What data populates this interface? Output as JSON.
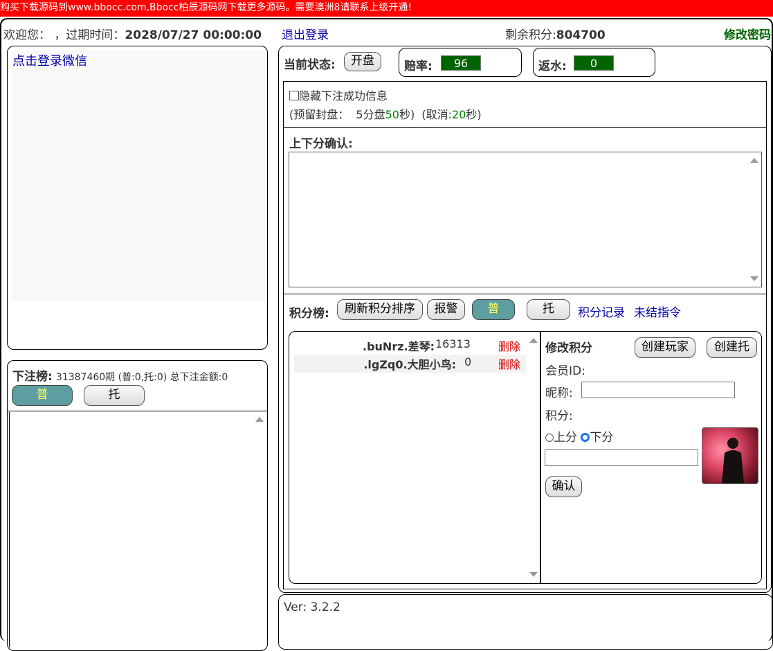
{
  "banner": {
    "text": "购买下载源码到www.bbocc.com,Bbocc柏辰源码网下载更多源码。需要澳洲8请联系上级开通!"
  },
  "header": {
    "welcome": "欢迎您： ，过期时间：",
    "expire": "2028/07/27 00:00:00",
    "logout": "退出登录",
    "points_label": "剩余积分:",
    "points_value": "804700",
    "change_password": "修改密码"
  },
  "wechat": {
    "login_link": "点击登录微信"
  },
  "bet_board": {
    "title": "下注榜:",
    "info": "31387460期  (普:0,托:0)  总下注金额:0",
    "btn_normal": "普",
    "btn_tuo": "托"
  },
  "status": {
    "label": "当前状态:",
    "open_btn": "开盘",
    "odds_label": "赔率:",
    "odds_value": "96",
    "rebate_label": "返水:",
    "rebate_value": "0"
  },
  "options": {
    "hide_success": "隐藏下注成功信息",
    "reserve_prefix": "(预留封盘：  5分盘",
    "reserve_value": "50",
    "reserve_suffix": "秒)",
    "cancel_prefix": "(取消:",
    "cancel_value": "20",
    "cancel_suffix": "秒)"
  },
  "confirm": {
    "title": "上下分确认:"
  },
  "leaderboard": {
    "title": "积分榜:",
    "refresh_btn": "刷新积分排序",
    "alarm_btn": "报警",
    "normal_btn": "普",
    "tuo_btn": "托",
    "records_link": "积分记录",
    "pending_link": "未结指令",
    "rows": [
      {
        "name": ".buNrz.差琴:",
        "score": "16313",
        "action": "删除"
      },
      {
        "name": ".lgZq0.大胆小鸟:",
        "score": "0",
        "action": "删除"
      }
    ]
  },
  "modify": {
    "title": "修改积分",
    "create_player": "创建玩家",
    "create_tuo": "创建托",
    "member_id_label": "会员ID:",
    "nickname_label": "昵称:",
    "points_label": "积分:",
    "up_label": "上分",
    "down_label": "下分",
    "confirm_btn": "确认"
  },
  "footer": {
    "version": "Ver: 3.2.2"
  },
  "colors": {
    "banner": "#ff0000",
    "accent_teal": "#5f9ea0",
    "value_green": "#006400",
    "link": "#0000a0",
    "delete_red": "#d00000"
  }
}
